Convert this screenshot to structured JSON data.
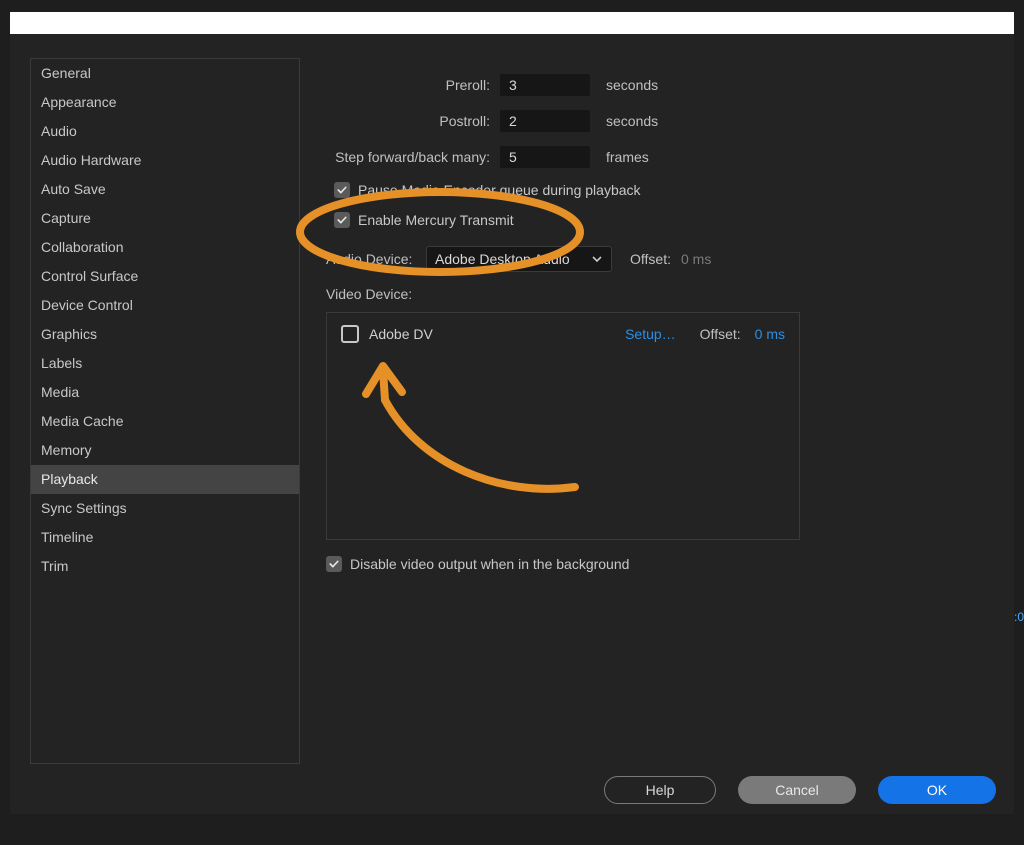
{
  "sidebar": {
    "items": [
      {
        "label": "General"
      },
      {
        "label": "Appearance"
      },
      {
        "label": "Audio"
      },
      {
        "label": "Audio Hardware"
      },
      {
        "label": "Auto Save"
      },
      {
        "label": "Capture"
      },
      {
        "label": "Collaboration"
      },
      {
        "label": "Control Surface"
      },
      {
        "label": "Device Control"
      },
      {
        "label": "Graphics"
      },
      {
        "label": "Labels"
      },
      {
        "label": "Media"
      },
      {
        "label": "Media Cache"
      },
      {
        "label": "Memory"
      },
      {
        "label": "Playback"
      },
      {
        "label": "Sync Settings"
      },
      {
        "label": "Timeline"
      },
      {
        "label": "Trim"
      }
    ],
    "selected_index": 14
  },
  "playback": {
    "preroll_label": "Preroll:",
    "preroll_value": "3",
    "preroll_unit": "seconds",
    "postroll_label": "Postroll:",
    "postroll_value": "2",
    "postroll_unit": "seconds",
    "step_label": "Step forward/back many:",
    "step_value": "5",
    "step_unit": "frames",
    "pause_encoder_label": "Pause Media Encoder queue during playback",
    "mercury_label": "Enable Mercury Transmit",
    "audio_device_label": "Audio Device:",
    "audio_device_value": "Adobe Desktop Audio",
    "audio_offset_label": "Offset:",
    "audio_offset_value": "0 ms",
    "video_device_label": "Video Device:",
    "video_devices": [
      {
        "name": "Adobe DV",
        "setup": "Setup…",
        "offset_label": "Offset:",
        "offset_value": "0 ms"
      }
    ],
    "disable_bg_label": "Disable video output when in the background"
  },
  "buttons": {
    "help": "Help",
    "cancel": "Cancel",
    "ok": "OK"
  },
  "annotation": {
    "circle_color": "#e69128",
    "arrow_color": "#e69128"
  },
  "bg_hint": ":0"
}
